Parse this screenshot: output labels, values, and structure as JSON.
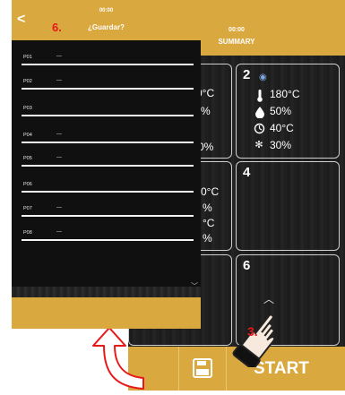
{
  "summary": {
    "time": "00:00",
    "title": "SUMMARY",
    "tiles": [
      {
        "number": "",
        "rows": [
          "0°C",
          "%",
          "",
          "0%"
        ]
      },
      {
        "number": "2",
        "rows": [
          "180°C",
          "50%",
          "40°C",
          "30%"
        ],
        "icons": [
          "thermometer-icon",
          "humidity-drop-icon",
          "timer-icon",
          "fan-icon"
        ]
      },
      {
        "number": "",
        "rows": [
          "0°C",
          "%",
          "°C",
          "%"
        ]
      },
      {
        "number": "4",
        "rows": []
      },
      {
        "number": "",
        "rows": []
      },
      {
        "number": "6",
        "rows": []
      }
    ],
    "start_label": "START",
    "save_icon": "floppy-disk-icon"
  },
  "guardar": {
    "time": "00:00",
    "title": "¿Guardar?",
    "back_icon": "chevron-left-icon",
    "programs": [
      {
        "label": "P01",
        "value": "---"
      },
      {
        "label": "P02",
        "value": "---"
      },
      {
        "label": "P03",
        "value": ""
      },
      {
        "label": "P04",
        "value": "---"
      },
      {
        "label": "P05",
        "value": "---"
      },
      {
        "label": "P06",
        "value": ""
      },
      {
        "label": "P07",
        "value": "---"
      },
      {
        "label": "P08",
        "value": "---"
      }
    ]
  },
  "steps": {
    "step6": "6.",
    "step3": "3."
  },
  "colors": {
    "header": "#d9a83f",
    "step": "#e81818",
    "background": "#161616"
  }
}
